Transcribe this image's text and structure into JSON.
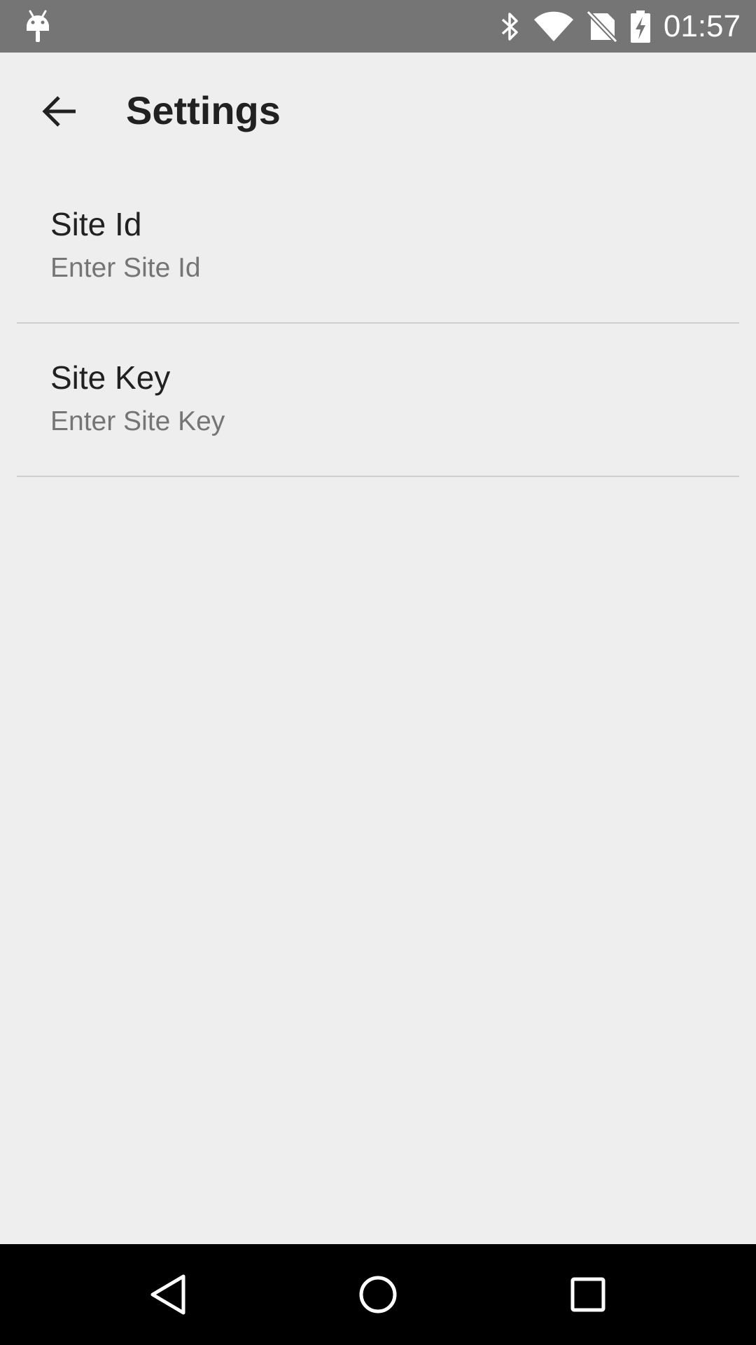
{
  "status_bar": {
    "time": "01:57",
    "icons": [
      "android-debug-icon",
      "bluetooth-icon",
      "wifi-icon",
      "no-sim-icon",
      "battery-charging-icon"
    ]
  },
  "app_bar": {
    "title": "Settings",
    "back_icon": "arrow-back-icon"
  },
  "preferences": [
    {
      "title": "Site Id",
      "summary": "Enter Site Id"
    },
    {
      "title": "Site Key",
      "summary": "Enter Site Key"
    }
  ],
  "nav_bar": {
    "icons": [
      "back-triangle-icon",
      "home-circle-icon",
      "recents-square-icon"
    ]
  },
  "colors": {
    "status_bar": "#757575",
    "background": "#eeeeee",
    "nav_bar": "#000000",
    "title_text": "#212121",
    "summary_text": "#757575",
    "divider": "#cfcfcf"
  }
}
